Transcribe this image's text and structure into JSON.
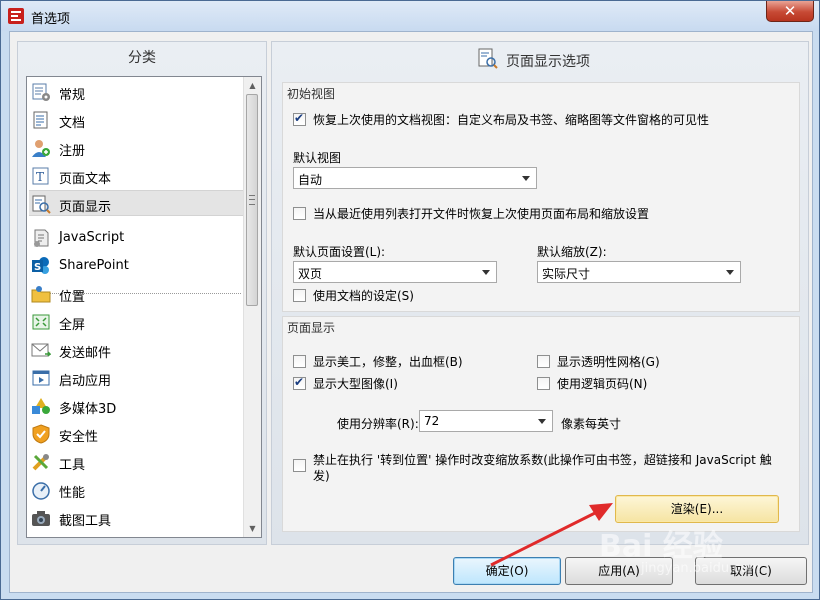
{
  "window": {
    "title": "首选项",
    "close_glyph": "✕"
  },
  "left": {
    "header": "分类",
    "items": [
      {
        "label": "常规",
        "icon": "general-settings-icon"
      },
      {
        "label": "文档",
        "icon": "document-icon"
      },
      {
        "label": "注册",
        "icon": "register-user-icon"
      },
      {
        "label": "页面文本",
        "icon": "text-icon"
      },
      {
        "label": "页面显示",
        "icon": "page-display-icon",
        "selected": true
      },
      {
        "label": "JavaScript",
        "icon": "javascript-icon"
      },
      {
        "label": "SharePoint",
        "icon": "sharepoint-icon"
      },
      {
        "label": "位置",
        "icon": "location-folder-icon"
      },
      {
        "label": "全屏",
        "icon": "fullscreen-icon"
      },
      {
        "label": "发送邮件",
        "icon": "email-icon"
      },
      {
        "label": "启动应用",
        "icon": "launch-app-icon"
      },
      {
        "label": "多媒体3D",
        "icon": "multimedia-3d-icon"
      },
      {
        "label": "安全性",
        "icon": "security-shield-icon"
      },
      {
        "label": "工具",
        "icon": "tools-icon"
      },
      {
        "label": "性能",
        "icon": "performance-gauge-icon"
      },
      {
        "label": "截图工具",
        "icon": "camera-icon"
      }
    ]
  },
  "right": {
    "header": "页面显示选项",
    "initial_view": {
      "title": "初始视图",
      "restore_view_label": "恢复上次使用的文档视图：自定义布局及书签、缩略图等文件窗格的可见性",
      "restore_view_checked": true,
      "default_view_label": "默认视图",
      "default_view_value": "自动",
      "restore_recent_label": "当从最近使用列表打开文件时恢复上次使用页面布局和缩放设置",
      "restore_recent_checked": false,
      "default_page_label": "默认页面设置(L):",
      "default_page_value": "双页",
      "default_zoom_label": "默认缩放(Z):",
      "default_zoom_value": "实际尺寸",
      "use_doc_settings_label": "使用文档的设定(S)",
      "use_doc_settings_checked": false
    },
    "page_display": {
      "title": "页面显示",
      "show_art_label": "显示美工，修整，出血框(B)",
      "show_art_checked": false,
      "show_grid_label": "显示透明性网格(G)",
      "show_grid_checked": false,
      "show_large_images_label": "显示大型图像(I)",
      "show_large_images_checked": true,
      "logical_page_label": "使用逻辑页码(N)",
      "logical_page_checked": false,
      "resolution_label": "使用分辨率(R):",
      "resolution_value": "72",
      "resolution_unit": "像素每英寸",
      "disable_zoom_label": "禁止在执行 '转到位置' 操作时改变缩放系数(此操作可由书签，超链接和 JavaScript 触",
      "disable_zoom_label_2": "发)",
      "disable_zoom_checked": false,
      "render_button": "渲染(E)..."
    }
  },
  "footer": {
    "ok": "确定(O)",
    "apply": "应用(A)",
    "cancel": "取消(C)"
  },
  "watermark": {
    "text": "Bai 经验",
    "sub": "jingyan.baidu.com"
  },
  "colors": {
    "accent_arrow": "#e02a2a",
    "selection": "#e4e4e4"
  }
}
